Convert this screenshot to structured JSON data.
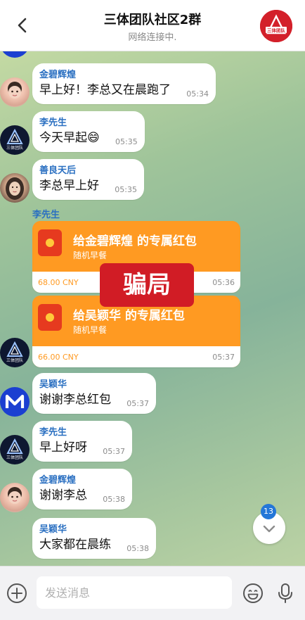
{
  "header": {
    "title": "三体团队社区2群",
    "subtitle": "网络连接中."
  },
  "avatars": {
    "group_text": "三体团队",
    "navy_text": "三体团队"
  },
  "messages": [
    {
      "sender": "金碧辉煌",
      "text": "早上好！李总又在晨跑了",
      "time": "05:34"
    },
    {
      "sender": "李先生",
      "text": "今天早起😄",
      "time": "05:35"
    },
    {
      "sender": "善良天后",
      "text": "李总早上好",
      "time": "05:35"
    },
    {
      "sender": "吴颖华",
      "text": "谢谢李总红包",
      "time": "05:37"
    },
    {
      "sender": "李先生",
      "text": "早上好呀",
      "time": "05:37"
    },
    {
      "sender": "金碧辉煌",
      "text": "谢谢李总",
      "time": "05:38"
    },
    {
      "sender": "吴颖华",
      "text": "大家都在晨练",
      "time": "05:38"
    }
  ],
  "red_packets": {
    "sender": "李先生",
    "items": [
      {
        "title": "给金碧辉煌 的专属红包",
        "subtitle": "随机早餐",
        "amount": "68.00 CNY",
        "time": "05:36"
      },
      {
        "title": "给吴颖华 的专属红包",
        "subtitle": "随机早餐",
        "amount": "66.00 CNY",
        "time": "05:37"
      }
    ]
  },
  "overlay": {
    "label": "骗局"
  },
  "scroll": {
    "unread_count": "13"
  },
  "input": {
    "placeholder": "发送消息"
  },
  "colors": {
    "accent": "#2477d8",
    "sender_name": "#2a6fc1",
    "red_packet": "#ff9a22",
    "scam_label": "#d11c25"
  }
}
